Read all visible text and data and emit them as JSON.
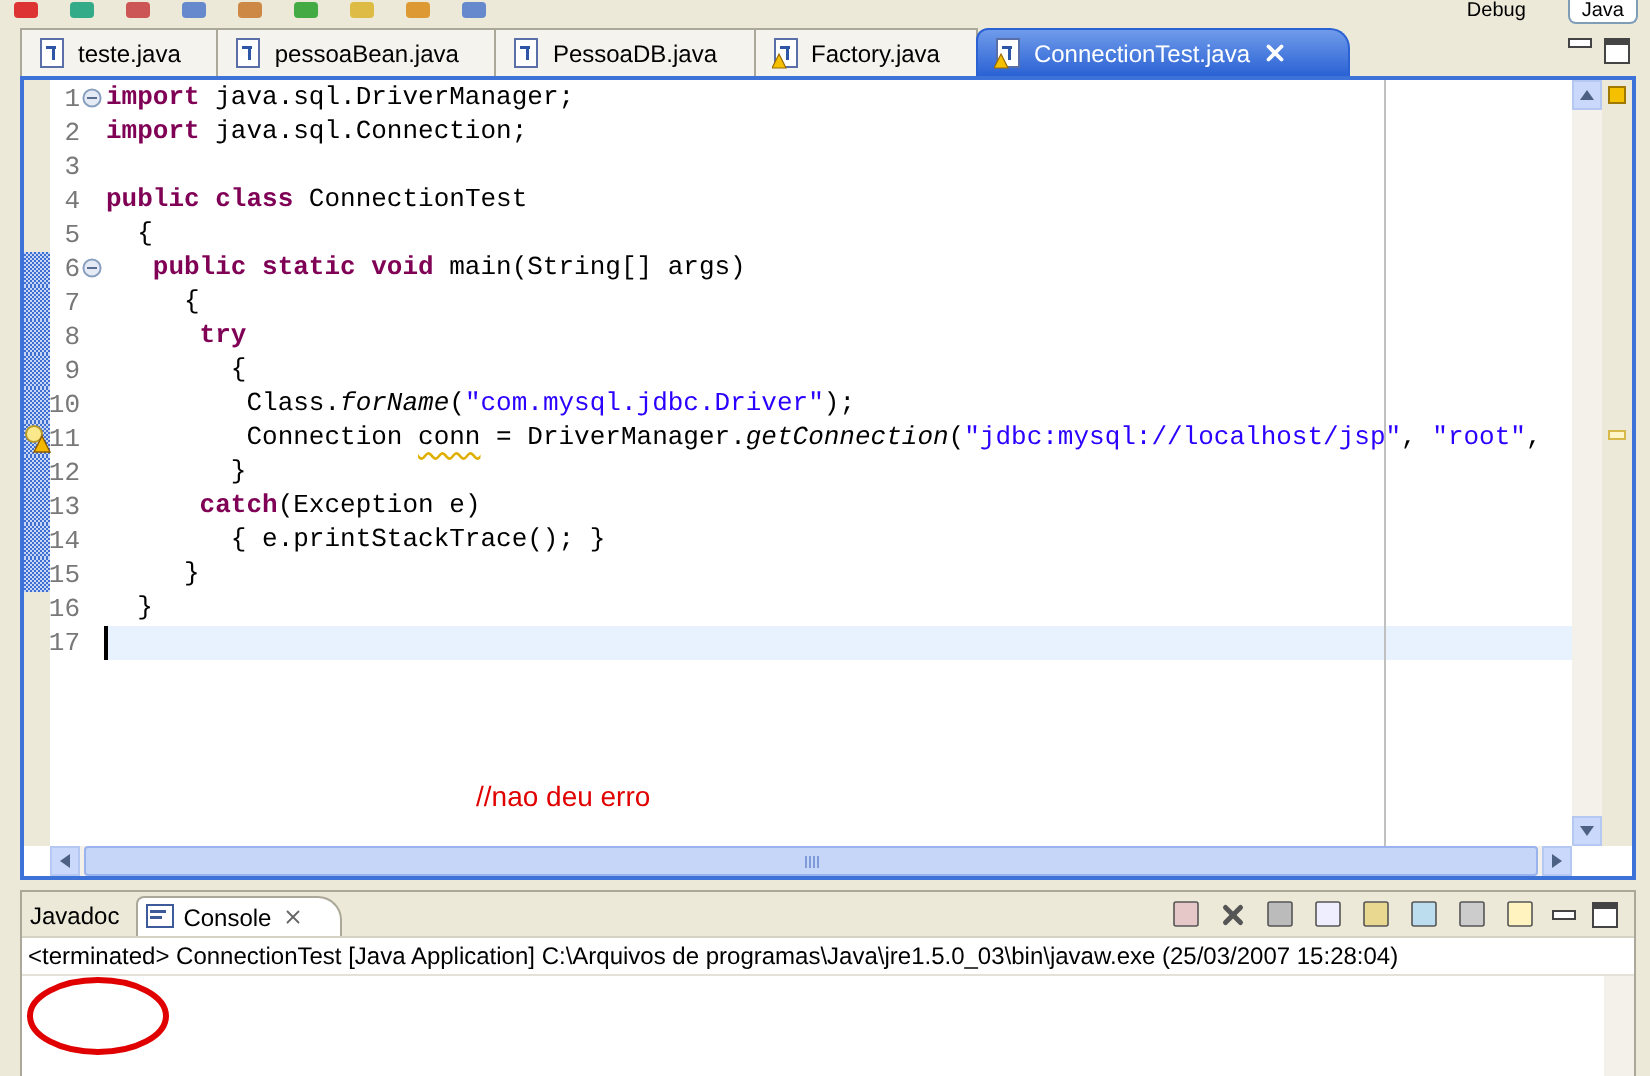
{
  "toolbar": {
    "perspectives": [
      {
        "label": "Debug",
        "selected": false
      },
      {
        "label": "Java",
        "selected": true
      }
    ]
  },
  "editor_tabs": [
    {
      "label": "teste.java",
      "warning": false,
      "selected": false
    },
    {
      "label": "pessoaBean.java",
      "warning": false,
      "selected": false
    },
    {
      "label": "PessoaDB.java",
      "warning": false,
      "selected": false
    },
    {
      "label": "Factory.java",
      "warning": true,
      "selected": false
    },
    {
      "label": "ConnectionTest.java",
      "warning": true,
      "selected": true
    }
  ],
  "editor": {
    "lines": [
      {
        "number": "1",
        "foldable": true,
        "warning": false,
        "changed": false,
        "current": false,
        "tokens": [
          {
            "kind": "keyword",
            "text": "import"
          },
          {
            "kind": "plain",
            "text": " java.sql.DriverManager;"
          }
        ]
      },
      {
        "number": "2",
        "foldable": false,
        "warning": false,
        "changed": false,
        "current": false,
        "tokens": [
          {
            "kind": "keyword",
            "text": "import"
          },
          {
            "kind": "plain",
            "text": " java.sql.Connection;"
          }
        ]
      },
      {
        "number": "3",
        "foldable": false,
        "warning": false,
        "changed": false,
        "current": false
      },
      {
        "number": "4",
        "foldable": false,
        "warning": false,
        "changed": false,
        "current": false,
        "tokens": [
          {
            "kind": "keyword",
            "text": "public class"
          },
          {
            "kind": "plain",
            "text": " ConnectionTest"
          }
        ]
      },
      {
        "number": "5",
        "foldable": false,
        "warning": false,
        "changed": false,
        "current": false,
        "tokens": [
          {
            "kind": "plain",
            "text": "  {"
          }
        ]
      },
      {
        "number": "6",
        "foldable": true,
        "warning": false,
        "changed": true,
        "current": false,
        "tokens": [
          {
            "kind": "keyword",
            "text": "   public static void"
          },
          {
            "kind": "plain",
            "text": " main(String[] args)"
          }
        ]
      },
      {
        "number": "7",
        "foldable": false,
        "warning": false,
        "changed": true,
        "current": false,
        "tokens": [
          {
            "kind": "plain",
            "text": "     {"
          }
        ]
      },
      {
        "number": "8",
        "foldable": false,
        "warning": false,
        "changed": true,
        "current": false,
        "tokens": [
          {
            "kind": "keyword",
            "text": "      try"
          }
        ]
      },
      {
        "number": "9",
        "foldable": false,
        "warning": false,
        "changed": true,
        "current": false,
        "tokens": [
          {
            "kind": "plain",
            "text": "        {"
          }
        ]
      },
      {
        "number": "10",
        "foldable": false,
        "warning": false,
        "changed": true,
        "current": false,
        "tokens": [
          {
            "kind": "plain",
            "text": "         Class."
          },
          {
            "kind": "method",
            "text": "forName"
          },
          {
            "kind": "plain",
            "text": "("
          },
          {
            "kind": "string",
            "text": "\"com.mysql.jdbc.Driver\""
          },
          {
            "kind": "plain",
            "text": ");"
          }
        ]
      },
      {
        "number": "11",
        "foldable": false,
        "warning": true,
        "changed": true,
        "current": false,
        "tokens": [
          {
            "kind": "plain",
            "text": "         Connection "
          },
          {
            "kind": "warn",
            "text": "conn"
          },
          {
            "kind": "plain",
            "text": " = DriverManager."
          },
          {
            "kind": "method",
            "text": "getConnection"
          },
          {
            "kind": "plain",
            "text": "("
          },
          {
            "kind": "string",
            "text": "\"jdbc:mysql://localhost/jsp\""
          },
          {
            "kind": "plain",
            "text": ", "
          },
          {
            "kind": "string",
            "text": "\"root\""
          },
          {
            "kind": "plain",
            "text": ","
          }
        ]
      },
      {
        "number": "12",
        "foldable": false,
        "warning": false,
        "changed": true,
        "current": false,
        "tokens": [
          {
            "kind": "plain",
            "text": "        }"
          }
        ]
      },
      {
        "number": "13",
        "foldable": false,
        "warning": false,
        "changed": true,
        "current": false,
        "tokens": [
          {
            "kind": "keyword",
            "text": "      catch"
          },
          {
            "kind": "plain",
            "text": "(Exception e)"
          }
        ]
      },
      {
        "number": "14",
        "foldable": false,
        "warning": false,
        "changed": true,
        "current": false,
        "tokens": [
          {
            "kind": "plain",
            "text": "        { e.printStackTrace(); }"
          }
        ]
      },
      {
        "number": "15",
        "foldable": false,
        "warning": false,
        "changed": true,
        "current": false,
        "tokens": [
          {
            "kind": "plain",
            "text": "     }"
          }
        ]
      },
      {
        "number": "16",
        "foldable": false,
        "warning": false,
        "changed": false,
        "current": false,
        "tokens": [
          {
            "kind": "plain",
            "text": "  }"
          }
        ]
      },
      {
        "number": "17",
        "foldable": false,
        "warning": false,
        "changed": false,
        "current": true
      }
    ],
    "annotation": "//nao deu erro"
  },
  "console": {
    "tabs": [
      {
        "label": "Javadoc",
        "selected": false,
        "closable": false
      },
      {
        "label": "Console",
        "selected": true,
        "closable": true
      }
    ],
    "status": "<terminated> ConnectionTest [Java Application] C:\\Arquivos de programas\\Java\\jre1.5.0_03\\bin\\javaw.exe (25/03/2007 15:28:04)"
  }
}
